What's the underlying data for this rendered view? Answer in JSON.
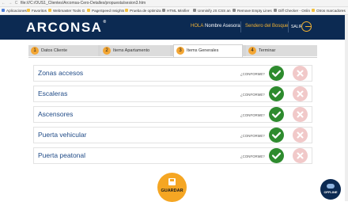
{
  "browser": {
    "nav_icons": "← → C",
    "url": "file:///C:/OUS1_Clientes/Arcomsa-Cero-Detalles/propuesta/sesion3.htm",
    "bookmarks": [
      {
        "label": "Aplicaciones",
        "color": "#4f7fd8"
      },
      {
        "label": "Favoritos",
        "color": "#f0c040"
      },
      {
        "label": "Webmaster Tools G",
        "color": "#f0c040"
      },
      {
        "label": "PageSpeed Insights",
        "color": "#f0c040"
      },
      {
        "label": "Prueba de optimiza",
        "color": "#f0c040"
      },
      {
        "label": "HTML Minifier",
        "color": "#888888"
      },
      {
        "label": "Unminify JS CSS an",
        "color": "#888888"
      },
      {
        "label": "Remove Empty Lines",
        "color": "#888888"
      },
      {
        "label": "Diff Checker - Onlin",
        "color": "#888888"
      },
      {
        "label": "Otros marcadores",
        "color": "#f0c040"
      }
    ]
  },
  "header": {
    "logo": "ARCONSA",
    "logo_mark": "®",
    "greeting": "HOLA",
    "user": "Nombre Asesora",
    "project": "Sendero del Bosque",
    "logout": "SALIR"
  },
  "tabs": [
    {
      "num": "1",
      "label": "Datos Cliente"
    },
    {
      "num": "2",
      "label": "Items Apartamento"
    },
    {
      "num": "3",
      "label": "Items Generales"
    },
    {
      "num": "4",
      "label": "Terminar"
    }
  ],
  "rows": [
    {
      "label": "Zonas accesos",
      "confirm": "¿CONFORME?"
    },
    {
      "label": "Escaleras",
      "confirm": "¿CONFORME?"
    },
    {
      "label": "Ascensores",
      "confirm": "¿CONFORME?"
    },
    {
      "label": "Puerta vehicular",
      "confirm": "¿CONFORME?"
    },
    {
      "label": "Puerta peatonal",
      "confirm": "¿CONFORME?"
    }
  ],
  "save_label": "GUARDAR",
  "offline_label": "OFFLINE",
  "colors": {
    "header": "#0c2a52",
    "accent": "#f3a634",
    "ok": "#2e8b2e",
    "no": "#f1c9c9"
  }
}
